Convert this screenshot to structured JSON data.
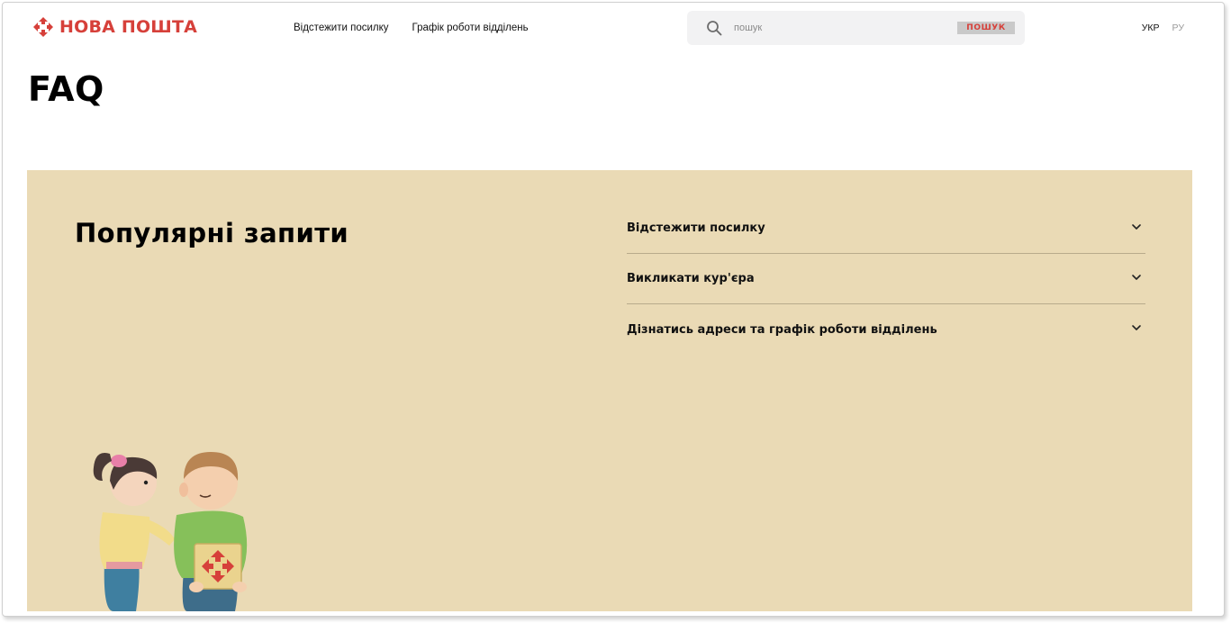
{
  "header": {
    "logo_text": "НОВА ПОШТА",
    "brand_color": "#d6403a",
    "nav": [
      {
        "label": "Відстежити посилку"
      },
      {
        "label": "Графік роботи відділень"
      }
    ],
    "search": {
      "placeholder": "пошук",
      "button_label": "ПОШУК",
      "icon": "search-icon"
    },
    "languages": [
      {
        "label": "УКР",
        "active": true
      },
      {
        "label": "РУ",
        "active": false
      }
    ]
  },
  "page_title": "FAQ",
  "popular": {
    "title": "Популярні запити",
    "background": "#eadab5",
    "items": [
      {
        "label": "Відстежити посилку",
        "icon": "chevron-down-icon"
      },
      {
        "label": "Викликати кур'єра",
        "icon": "chevron-down-icon"
      },
      {
        "label": "Дізнатись адреси та графік роботи відділень",
        "icon": "chevron-down-icon"
      }
    ]
  }
}
